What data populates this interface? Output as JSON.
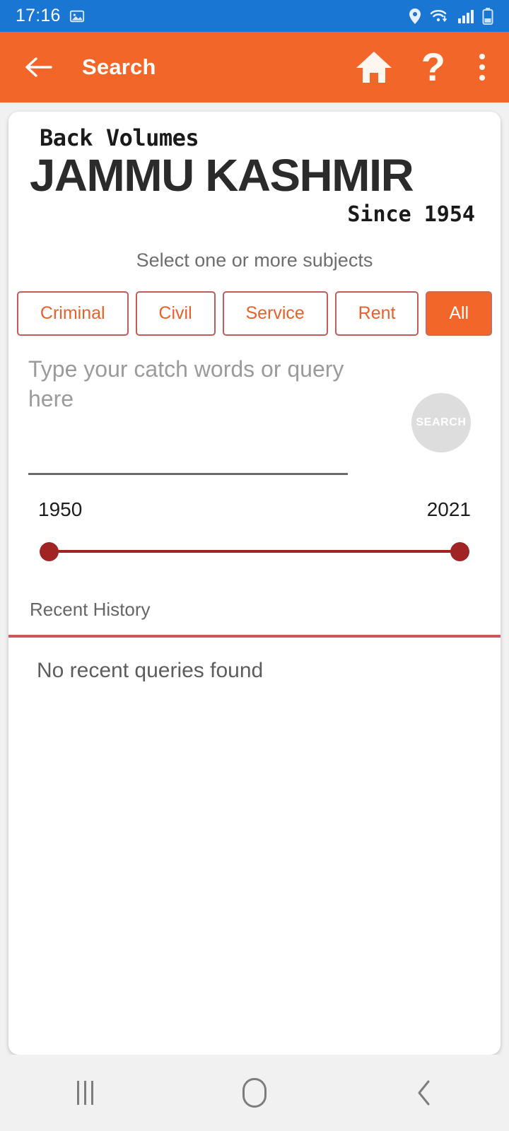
{
  "status_bar": {
    "time": "17:16",
    "icons": [
      "image-icon",
      "location-icon",
      "wifi-icon",
      "signal-icon",
      "battery-icon"
    ],
    "background": "#1976d2"
  },
  "toolbar": {
    "title": "Search",
    "back_icon": "arrow-left-icon",
    "home_icon": "home-icon",
    "help_label": "?",
    "overflow_icon": "more-vertical-icon",
    "background": "#f26729"
  },
  "logo": {
    "line1": "Back Volumes",
    "line2": "JAMMU KASHMIR",
    "line3": "Since 1954"
  },
  "subjects": {
    "label": "Select one or more subjects",
    "chips": [
      {
        "label": "Criminal",
        "selected": false
      },
      {
        "label": "Civil",
        "selected": false
      },
      {
        "label": "Service",
        "selected": false
      },
      {
        "label": "Rent",
        "selected": false
      },
      {
        "label": "All",
        "selected": true
      }
    ],
    "accent": "#f26729",
    "border": "#c25b5b"
  },
  "query": {
    "placeholder": "Type your catch words or query here",
    "value": "",
    "search_button_label": "SEARCH",
    "search_button_color": "#dddddd"
  },
  "year_range": {
    "min_label": "1950",
    "max_label": "2021",
    "min": 1950,
    "max": 2021,
    "selected_low": 1950,
    "selected_high": 2021,
    "track_color": "#9d2423",
    "thumb_color": "#a02423"
  },
  "history": {
    "title": "Recent History",
    "divider_color": "#c8595c",
    "empty_message": "No recent queries found",
    "items": []
  },
  "navbar": {
    "recents_icon": "recents-icon",
    "home_icon": "home-square-icon",
    "back_icon": "chevron-left-icon"
  }
}
